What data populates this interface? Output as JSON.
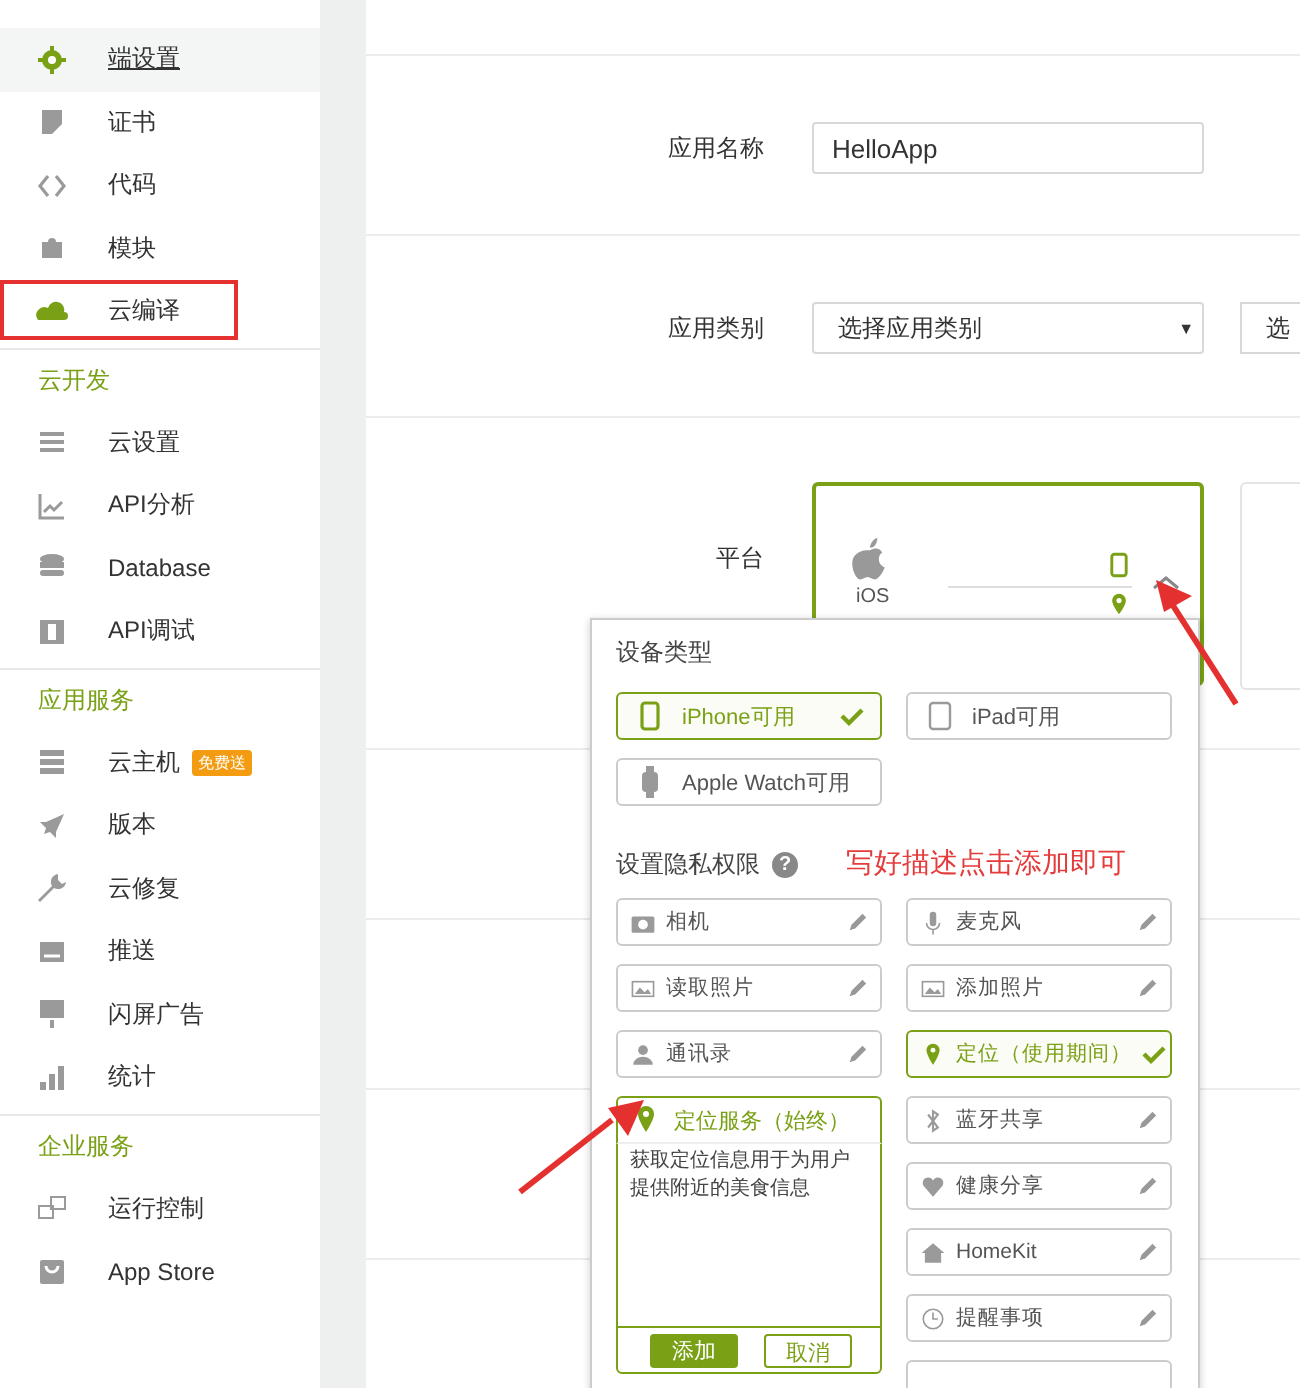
{
  "sidebar": {
    "groups": [
      {
        "items": [
          {
            "label": "端设置",
            "selected": true
          },
          {
            "label": "证书",
            "selected": false
          },
          {
            "label": "代码",
            "selected": false
          },
          {
            "label": "模块",
            "selected": false
          },
          {
            "label": "云编译",
            "selected": false
          }
        ]
      },
      {
        "heading": "云开发",
        "items": [
          {
            "label": "云设置",
            "selected": false
          },
          {
            "label": "API分析",
            "selected": false
          },
          {
            "label": "Database",
            "selected": false
          },
          {
            "label": "API调试",
            "selected": false
          }
        ]
      },
      {
        "heading": "应用服务",
        "items": [
          {
            "label": "云主机",
            "badge": "免费送",
            "selected": false
          },
          {
            "label": "版本",
            "selected": false
          },
          {
            "label": "云修复",
            "selected": false
          },
          {
            "label": "推送",
            "selected": false
          },
          {
            "label": "闪屏广告",
            "selected": false
          },
          {
            "label": "统计",
            "selected": false
          }
        ]
      },
      {
        "heading": "企业服务",
        "items": [
          {
            "label": "运行控制",
            "selected": false
          },
          {
            "label": "App Store",
            "selected": false
          }
        ]
      }
    ]
  },
  "form": {
    "app_name": {
      "label": "应用名称",
      "value": "HelloApp"
    },
    "category": {
      "label": "应用类别",
      "value": "选择应用类别",
      "caret": "▼",
      "second_value": "选"
    },
    "platform": {
      "label": "平台",
      "name": "iOS",
      "selected": true
    }
  },
  "popup": {
    "device_heading": "设备类型",
    "devices": [
      {
        "label": "iPhone可用",
        "selected": true
      },
      {
        "label": "iPad可用",
        "selected": false
      },
      {
        "label": "Apple Watch可用",
        "selected": false
      }
    ],
    "privacy_heading": "设置隐私权限",
    "help": "?",
    "annotation": "写好描述点击添加即可",
    "left": [
      {
        "kind": "row",
        "label": "相机",
        "selected": false
      },
      {
        "kind": "row",
        "label": "读取照片",
        "selected": false
      },
      {
        "kind": "row",
        "label": "通讯录",
        "selected": false
      },
      {
        "kind": "editor",
        "label": "定位服务（始终）",
        "text": "获取定位信息用于为用户提供附近的美食信息",
        "confirm": "添加",
        "cancel": "取消"
      }
    ],
    "right": [
      {
        "kind": "row",
        "label": "麦克风",
        "selected": false
      },
      {
        "kind": "row",
        "label": "添加照片",
        "selected": false
      },
      {
        "kind": "row",
        "label": "定位（使用期间）",
        "selected": true
      },
      {
        "kind": "row",
        "label": "蓝牙共享",
        "selected": false
      },
      {
        "kind": "row",
        "label": "健康分享",
        "selected": false
      },
      {
        "kind": "row",
        "label": "HomeKit",
        "selected": false
      },
      {
        "kind": "row",
        "label": "提醒事项",
        "selected": false
      },
      {
        "kind": "stub"
      }
    ]
  }
}
